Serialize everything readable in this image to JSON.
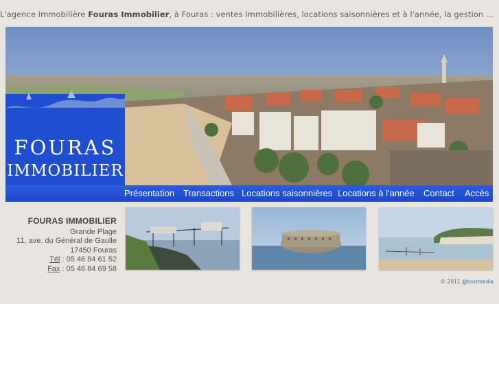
{
  "header": {
    "tagline_prefix": "L'agence immobilière ",
    "tagline_brand": "Fouras Immobilier",
    "tagline_suffix": ", à Fouras : ventes immobilières, locations saisonnières et à l'année, la gestion ..."
  },
  "logo": {
    "line1": "FOURAS",
    "line2": "IMMOBILIER",
    "color": "#1f4fd0"
  },
  "nav": {
    "items": [
      {
        "label": "Présentation"
      },
      {
        "label": "Transactions"
      },
      {
        "label": "Locations saisonnières"
      },
      {
        "label": "Locations à l'année"
      },
      {
        "label": "Contact"
      },
      {
        "label": "Accès"
      }
    ],
    "color": "#2352d6"
  },
  "contact": {
    "name": "FOURAS IMMOBILIER",
    "address1": "Grande Plage",
    "address2": "11, ave. du Général de Gaulle",
    "postal": "17450 Fouras",
    "tel_label": "Tél",
    "tel": " : 05 46 84 61 52",
    "fax_label": "Fax",
    "fax": " : 05 46 84 69 58"
  },
  "footer": {
    "copyright": "© 2011 ",
    "credit_link": "@toutmedia"
  }
}
